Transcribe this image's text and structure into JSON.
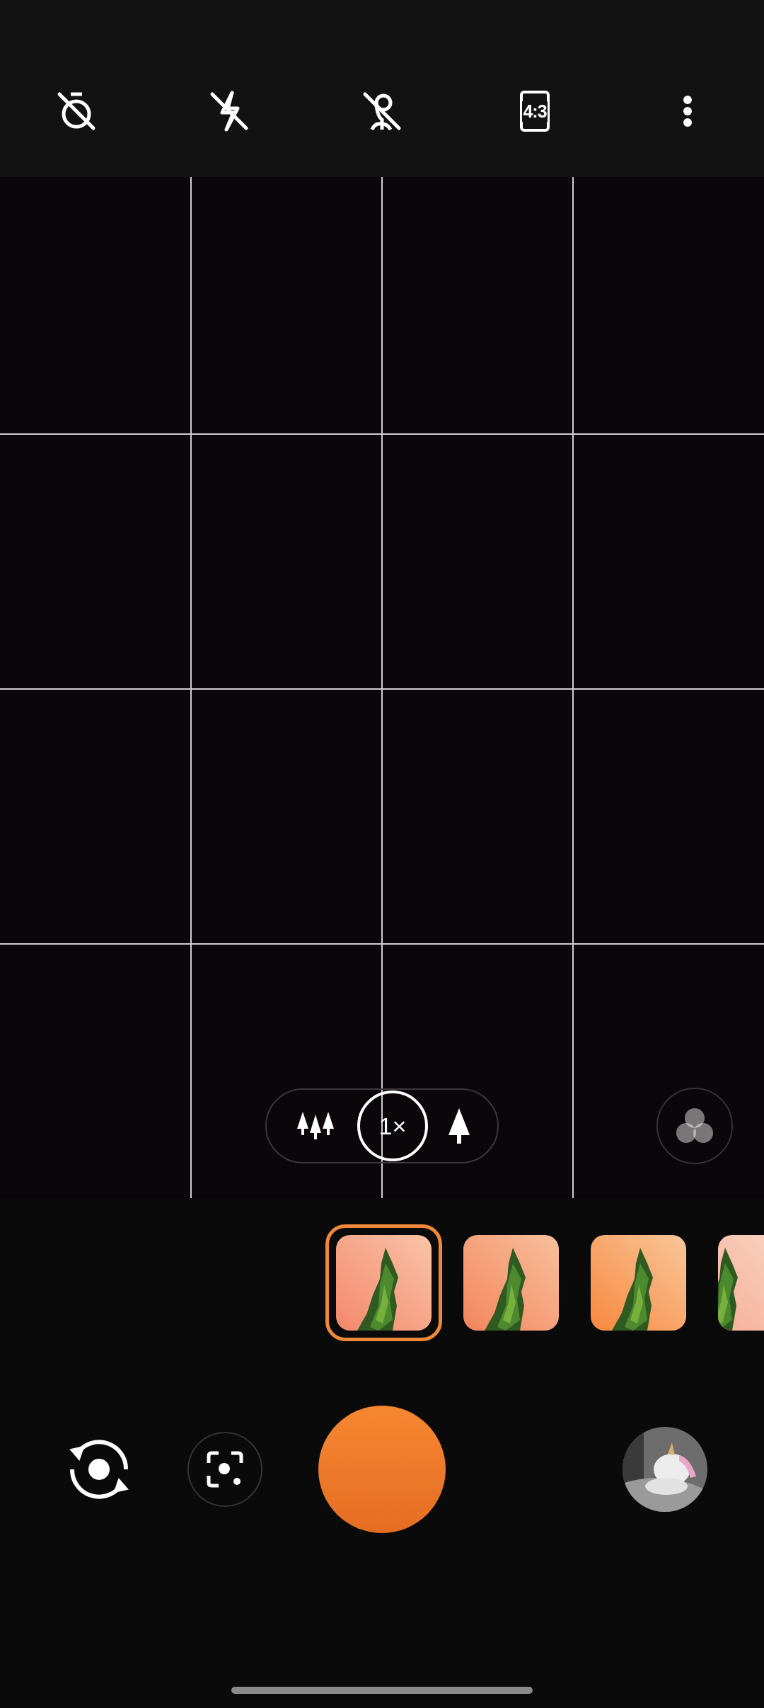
{
  "top_bar": {
    "aspect_ratio": "4:3"
  },
  "zoom": {
    "options": [
      {
        "kind": "wide",
        "selected": false
      },
      {
        "kind": "text",
        "label": "1×",
        "selected": true
      },
      {
        "kind": "tele",
        "selected": false
      }
    ]
  },
  "filters": [
    {
      "kind": "picture",
      "selected": true
    },
    {
      "kind": "picture",
      "selected": false
    },
    {
      "kind": "picture",
      "selected": false
    },
    {
      "kind": "picture",
      "selected": false
    }
  ],
  "gallery": {
    "kind": "picture"
  }
}
